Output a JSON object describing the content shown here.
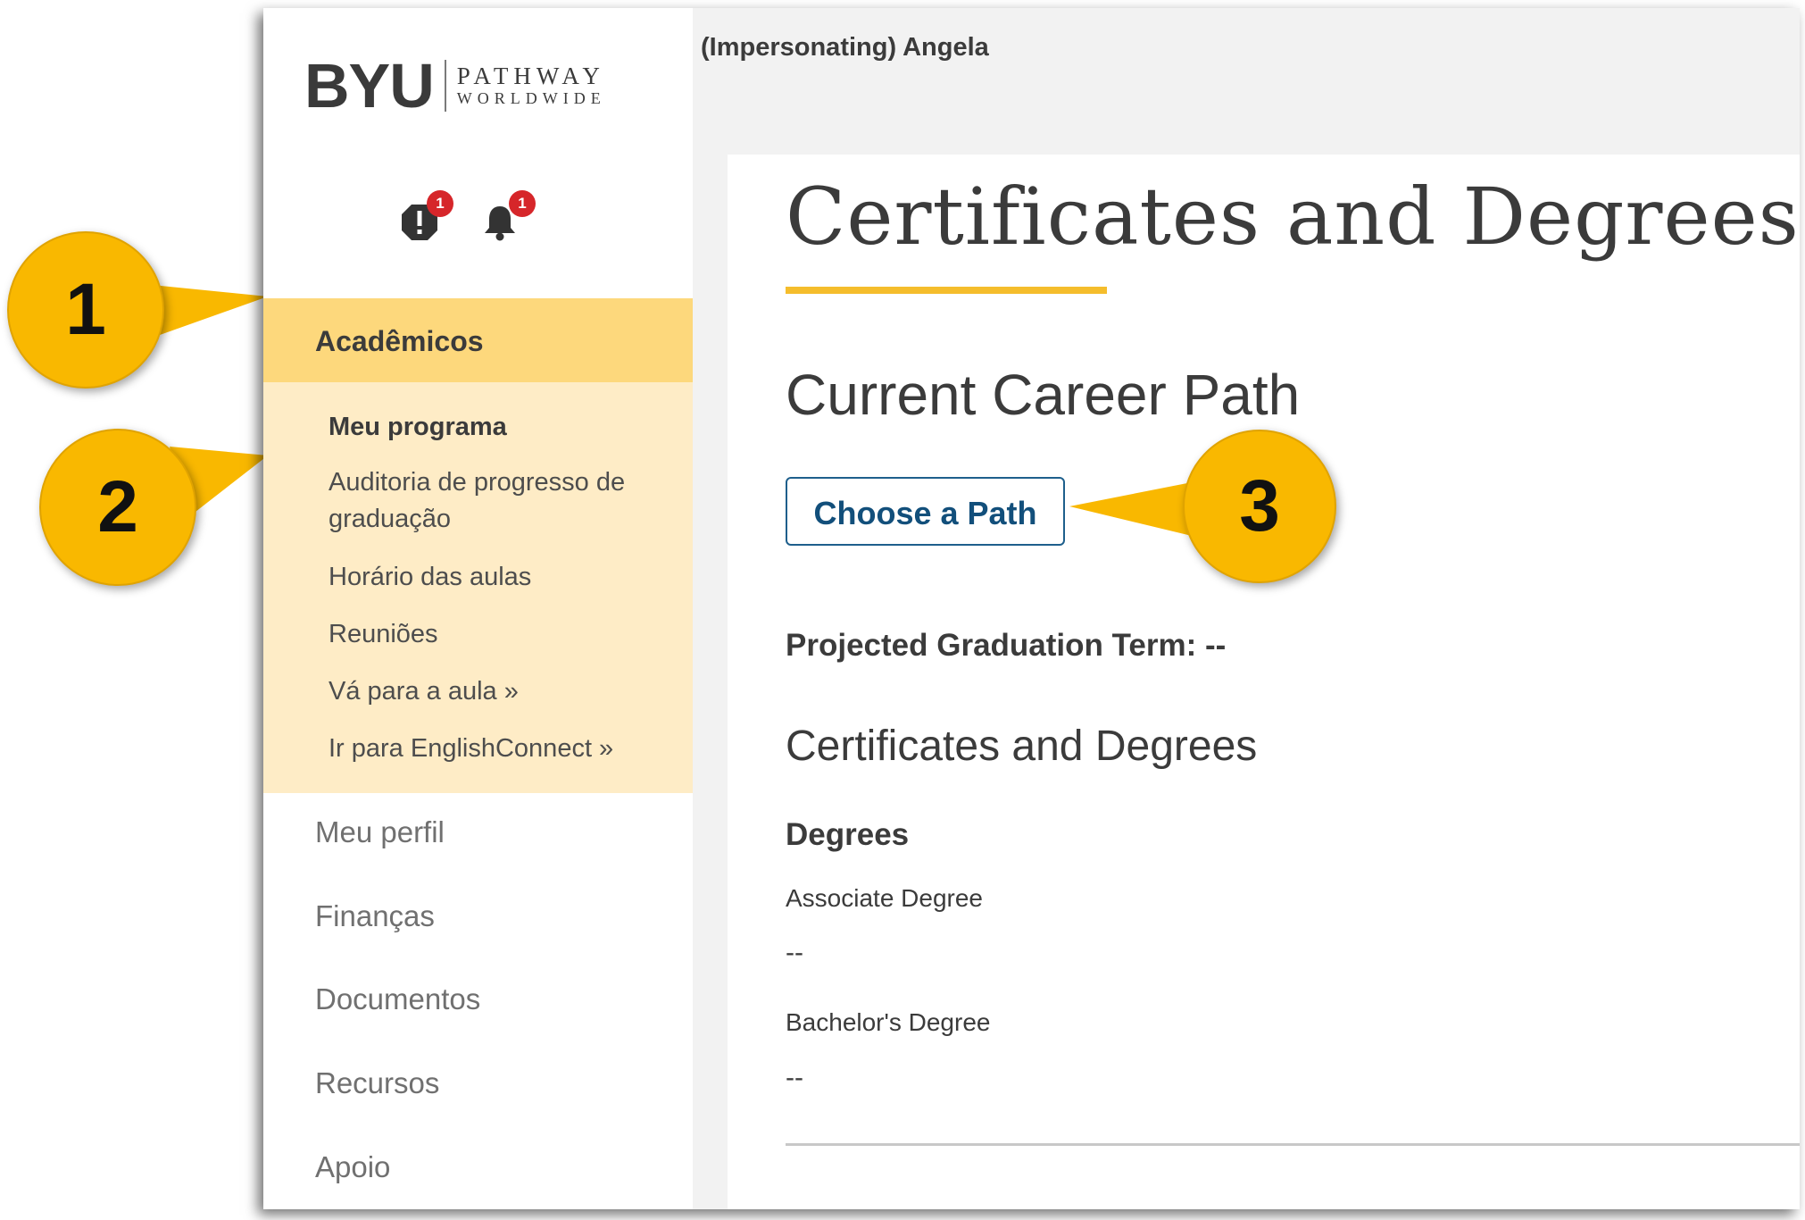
{
  "header": {
    "user_label": "(Impersonating) Angela"
  },
  "logo": {
    "brand": "BYU",
    "line1": "PATHWAY",
    "line2": "WORLDWIDE"
  },
  "notifications": {
    "alerts_count": "1",
    "bell_count": "1"
  },
  "sidebar": {
    "active_section": "Acadêmicos",
    "sub_items": [
      "Meu programa",
      "Auditoria de progresso de graduação",
      "Horário das aulas",
      "Reuniões",
      "Vá para a aula »",
      "Ir para EnglishConnect »"
    ],
    "items": [
      "Meu perfil",
      "Finanças",
      "Documentos",
      "Recursos",
      "Apoio"
    ]
  },
  "main": {
    "title": "Certificates and Degrees",
    "career_path_title": "Current Career Path",
    "choose_path_label": "Choose a Path",
    "graduation_term": "Projected Graduation Term: --",
    "certificates_title": "Certificates and Degrees",
    "degrees_heading": "Degrees",
    "degrees": [
      {
        "label": "Associate Degree",
        "value": "--"
      },
      {
        "label": "Bachelor's Degree",
        "value": "--"
      }
    ]
  },
  "callouts": [
    "1",
    "2",
    "3"
  ],
  "colors": {
    "accent_yellow": "#f5bd2c",
    "active_nav_bg": "#fdd87c",
    "subnav_bg": "#feecc6",
    "callout_fill": "#f9b800",
    "button_text": "#124f7b",
    "badge_red": "#d6262a"
  }
}
